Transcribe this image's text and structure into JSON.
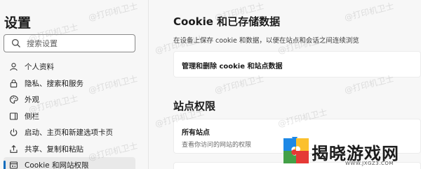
{
  "sidebar": {
    "title": "设置",
    "search_placeholder": "搜索设置",
    "items": [
      {
        "label": "个人资料",
        "icon": "profile-icon"
      },
      {
        "label": "隐私、搜索和服务",
        "icon": "lock-icon"
      },
      {
        "label": "外观",
        "icon": "palette-icon"
      },
      {
        "label": "侧栏",
        "icon": "sidebar-icon"
      },
      {
        "label": "启动、主页和新建选项卡页",
        "icon": "power-icon"
      },
      {
        "label": "共享、复制和粘贴",
        "icon": "share-icon"
      },
      {
        "label": "Cookie 和网站权限",
        "icon": "cookie-icon",
        "active": true
      }
    ]
  },
  "main": {
    "cookie_section": {
      "title": "Cookie 和已存储数据",
      "desc": "在设备上保存 cookie 和数据，以便在站点和会话之间连续浏览",
      "manage_card_title": "管理和删除 cookie 和站点数据"
    },
    "permissions_section": {
      "title": "站点权限",
      "all_sites_title": "所有站点",
      "all_sites_sub": "查看你访问的网站的权限"
    }
  },
  "watermark_text": "@打印机卫士",
  "logo": {
    "text": "揭晓游戏网",
    "url": "WWW.JXGZ3.COM"
  },
  "colors": {
    "accent": "#0f6cbd",
    "active_bg": "#e9e9e9"
  }
}
